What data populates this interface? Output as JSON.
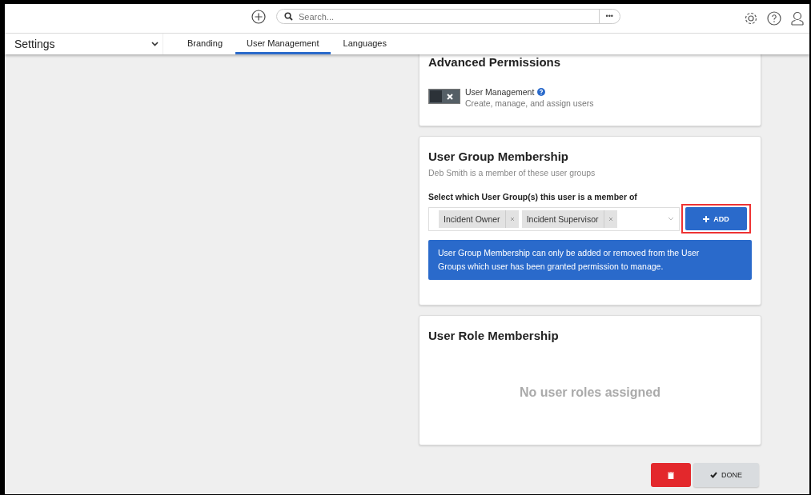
{
  "topbar": {
    "search": {
      "placeholder": "Search..."
    },
    "more": "•••"
  },
  "navbar": {
    "title": "Settings",
    "tabs": [
      {
        "label": "Branding",
        "selected": false
      },
      {
        "label": "User Management",
        "selected": true
      },
      {
        "label": "Languages",
        "selected": false
      }
    ]
  },
  "advanced_permissions": {
    "title": "Advanced Permissions",
    "permissions": [
      {
        "name": "User Management",
        "description": "Create, manage, and assign users",
        "on": false
      }
    ]
  },
  "user_group_membership": {
    "title": "User Group Membership",
    "subtitle": "Deb Smith is a member of these user groups",
    "field_label": "Select which User Group(s) this user is a member of",
    "groups": [
      "Incident Owner",
      "Incident Supervisor"
    ],
    "add_button": "ADD",
    "info": "User Group Membership can only be added or removed from the User Groups which user has been granted permission to manage."
  },
  "user_role_membership": {
    "title": "User Role Membership",
    "empty": "No user roles assigned"
  },
  "footer": {
    "done_button": "DONE"
  }
}
